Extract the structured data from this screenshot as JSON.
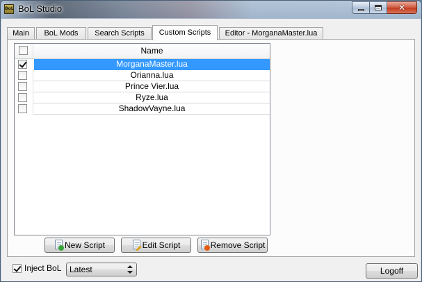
{
  "window": {
    "title": "BoL Studio",
    "icon_text": "BoL"
  },
  "tabs": [
    {
      "label": "Main"
    },
    {
      "label": "BoL Mods"
    },
    {
      "label": "Search Scripts"
    },
    {
      "label": "Custom Scripts",
      "active": true
    },
    {
      "label": "Editor - MorganaMaster.lua"
    }
  ],
  "script_table": {
    "header": "Name",
    "rows": [
      {
        "name": "MorganaMaster.lua",
        "checked": true,
        "selected": true
      },
      {
        "name": "Orianna.lua",
        "checked": false
      },
      {
        "name": "Prince Vier.lua",
        "checked": false
      },
      {
        "name": "Ryze.lua",
        "checked": false
      },
      {
        "name": "ShadowVayne.lua",
        "checked": false
      }
    ]
  },
  "actions": {
    "new_script": "New Script",
    "edit_script": "Edit Script",
    "remove_script": "Remove Script"
  },
  "footer": {
    "inject_label": "Inject BoL",
    "inject_checked": true,
    "version_select": "Latest",
    "logoff": "Logoff"
  },
  "icons": {
    "minimize": "minimize-icon",
    "maximize": "maximize-icon",
    "close": "close-icon",
    "new": "new-document-icon",
    "edit": "edit-document-icon",
    "remove": "remove-document-icon"
  },
  "colors": {
    "selection": "#3399ff",
    "close_button": "#c13b1c"
  }
}
